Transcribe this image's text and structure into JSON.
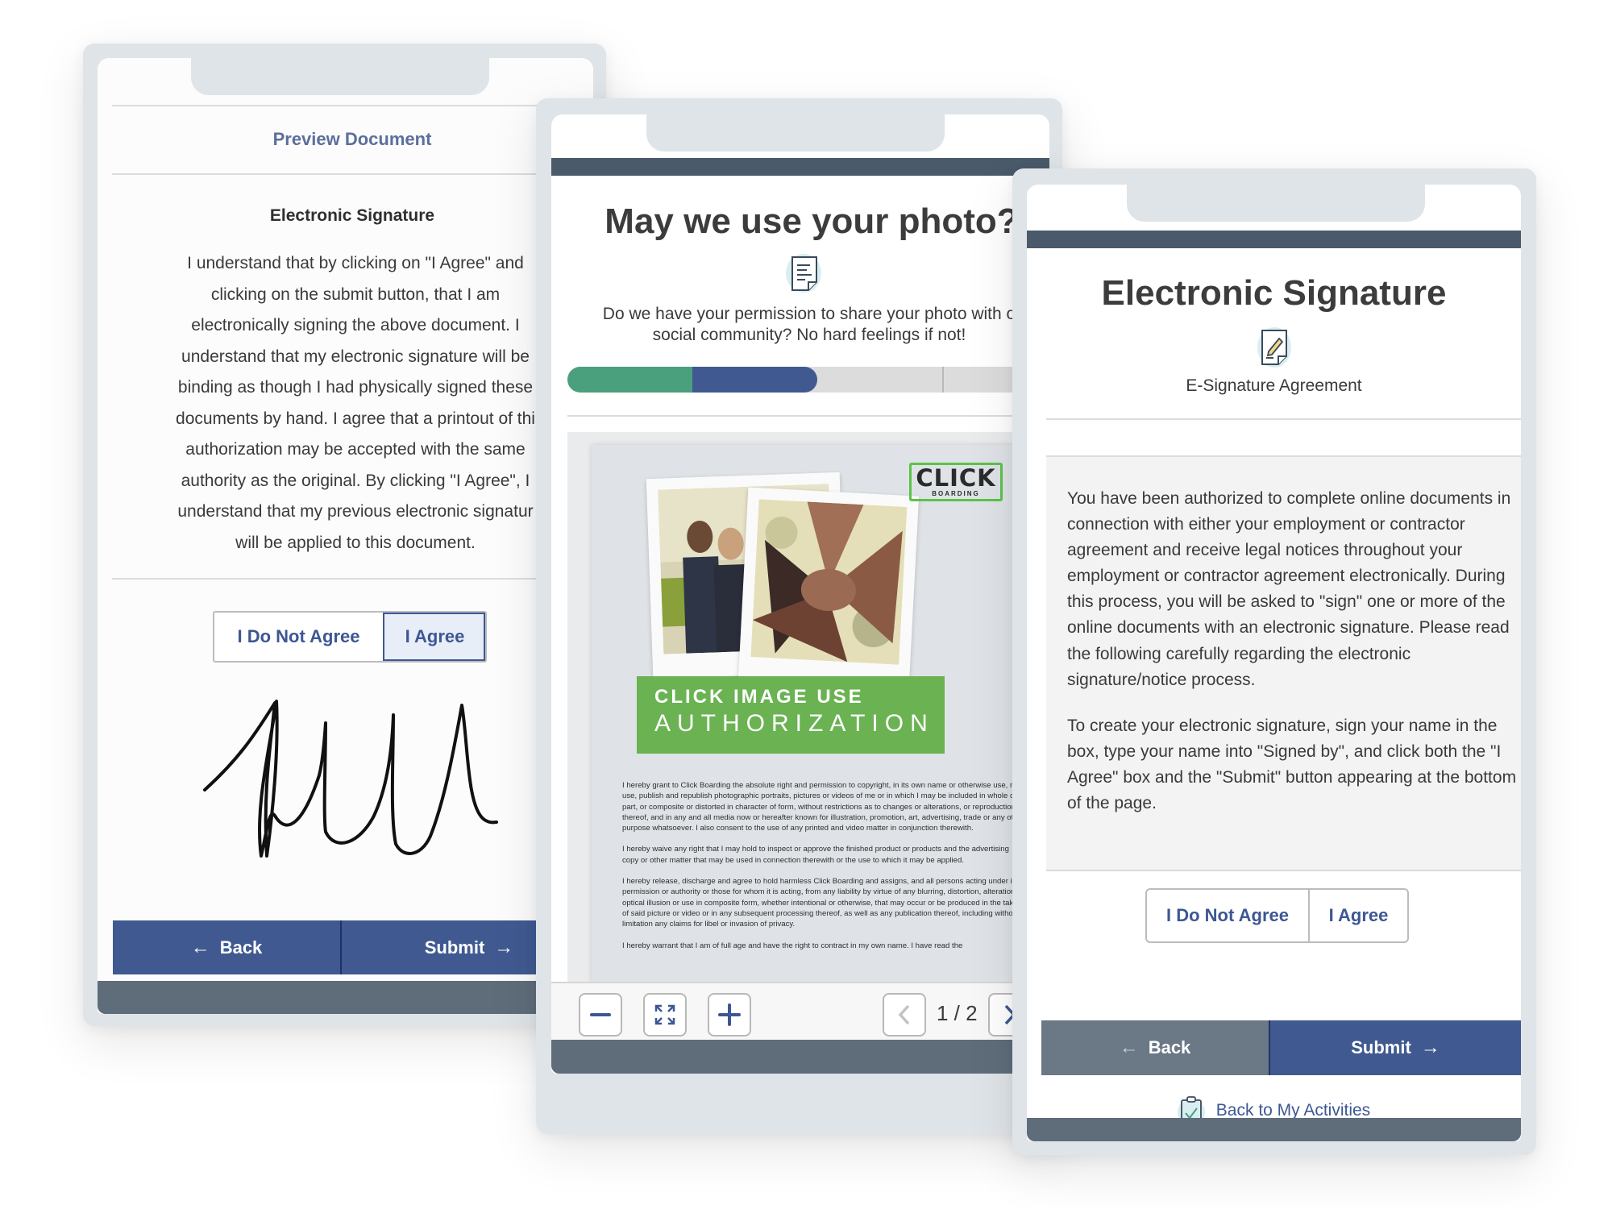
{
  "card1": {
    "preview_link": "Preview Document",
    "title": "Electronic Signature",
    "body_lines": [
      "I understand that by clicking on \"I Agree\" and",
      "clicking on the submit button, that I am",
      "electronically signing the above document. I",
      "understand that my electronic signature will be",
      "binding as though I had physically signed these",
      "documents by hand. I agree that a printout of thi",
      "authorization may be accepted with the same",
      "authority as the original. By clicking \"I Agree\", I",
      "understand that my previous electronic signatur",
      "will be applied to this document."
    ],
    "agree_options": {
      "disagree": "I Do Not Agree",
      "agree": "I Agree",
      "selected": "agree"
    },
    "signature_icon": "handwritten-signature",
    "back_label": "Back",
    "submit_label": "Submit"
  },
  "card2": {
    "title": "May we use your photo?",
    "icon": "document-icon",
    "subtitle_lines": [
      "Do we have your permission to share your photo with o",
      "social community? No hard feelings if not!"
    ],
    "progress": {
      "completed_steps": 1,
      "current_step": 2,
      "total_steps": 4,
      "colors": {
        "completed": "#4aa07c",
        "current": "#405a91",
        "remaining": "#dcdcdc"
      }
    },
    "document": {
      "logo_main": "CLICK",
      "logo_sub": "BOARDING",
      "banner_line1": "CLICK IMAGE USE",
      "banner_line2": "AUTHORIZATION",
      "paragraphs": [
        "I hereby grant to Click Boarding the absolute right and permission to copyright, in its own name or otherwise use, re-use, publish and republish photographic portraits, pictures or videos of me or in which I may be included in whole or in part, or composite or distorted in character of form, without restrictions as to changes or alterations, or reproductions thereof, and in any and all media now or hereafter known for illustration, promotion, art, advertising, trade or any other purpose whatsoever. I also consent to the use of any printed and video matter in conjunction therewith.",
        "I hereby waive any right that I may hold to inspect or approve the finished product or products and the advertising copy or other matter that may be used in connection therewith or the use to which it may be applied.",
        "I hereby release, discharge and agree to hold harmless Click Boarding and assigns, and all persons acting under its permission or authority or those for whom it is acting, from any liability by virtue of any blurring, distortion, alteration, optical illusion or use in composite form, whether intentional or otherwise, that may occur or be produced in the taking of said picture or video or in any subsequent processing thereof, as well as any publication thereof, including without limitation any claims for libel or invasion of privacy.",
        "I hereby warrant that I am of full age and have the right to contract in my own name. I have read the"
      ]
    },
    "toolbar": {
      "zoom_out": "zoom-out-icon",
      "fit": "expand-icon",
      "zoom_in": "zoom-in-icon",
      "page_indicator": "1 / 2",
      "current_page": 1,
      "total_pages": 2
    }
  },
  "card3": {
    "title": "Electronic Signature",
    "icon": "document-pencil-icon",
    "subtitle": "E-Signature Agreement",
    "paragraphs": [
      "You have been authorized to complete online documents in connection with either your employment or contractor agreement and receive legal notices throughout your employment or contractor agreement electronically. During this process, you will be asked to \"sign\" one or more of the online documents with an electronic signature. Please read the following carefully regarding the electronic signature/notice process.",
      "To create your electronic signature, sign your name in the box, type your name into \"Signed by\", and click both the \"I Agree\" box and the \"Submit\" button appearing at the bottom of the page."
    ],
    "agree_options": {
      "disagree": "I Do Not Agree",
      "agree": "I Agree"
    },
    "back_label": "Back",
    "submit_label": "Submit",
    "back_to_activities": "Back to My Activities"
  },
  "colors": {
    "primary": "#405a91",
    "accent_green": "#4aa07c",
    "frame": "#dfe4e8",
    "header_dark": "#4a5a6b",
    "back_grey": "#6b7885"
  }
}
